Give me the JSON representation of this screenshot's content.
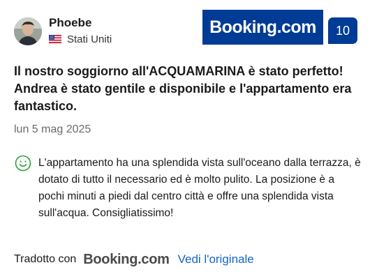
{
  "reviewer": {
    "name": "Phoebe",
    "country": "Stati Uniti",
    "flag_icon": "us-flag-icon"
  },
  "brand": {
    "logo_text": "Booking.com",
    "color": "#003b95"
  },
  "score": "10",
  "review": {
    "title": "Il nostro soggiorno all'ACQUAMARINA è stato perfetto! Andrea è stato gentile e disponibile e l'appartamento era fantastico.",
    "date": "lun 5 mag 2025",
    "sentiment_icon": "smiley-icon",
    "sentiment_color": "#2e9e3e",
    "body": "L'appartamento ha una splendida vista sull'oceano dalla terrazza, è dotato di tutto il necessario ed è molto pulito. La posizione è a pochi minuti a piedi dal centro città e offre una splendida vista sull'acqua. Consigliatissimo!"
  },
  "translation": {
    "label": "Tradotto con",
    "provider": "Booking.com",
    "see_original": "Vedi l'originale",
    "link_color": "#1264c8"
  }
}
